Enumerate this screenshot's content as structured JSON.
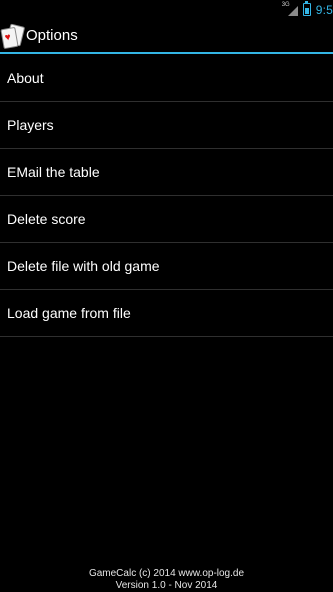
{
  "status_bar": {
    "network_label": "3G",
    "time": "9:5",
    "accent_color": "#33b5e5"
  },
  "action_bar": {
    "title": "Options",
    "app_icon": "playing-cards-icon"
  },
  "menu": {
    "items": [
      {
        "label": "About"
      },
      {
        "label": "Players"
      },
      {
        "label": "EMail the table"
      },
      {
        "label": "Delete score"
      },
      {
        "label": "Delete file with old game"
      },
      {
        "label": "Load game from file"
      }
    ]
  },
  "footer": {
    "line1": "GameCalc (c) 2014 www.op-log.de",
    "line2": "Version 1.0 - Nov 2014"
  },
  "colors": {
    "background": "#000000",
    "divider": "#2f2f2f",
    "accent": "#33b5e5"
  }
}
